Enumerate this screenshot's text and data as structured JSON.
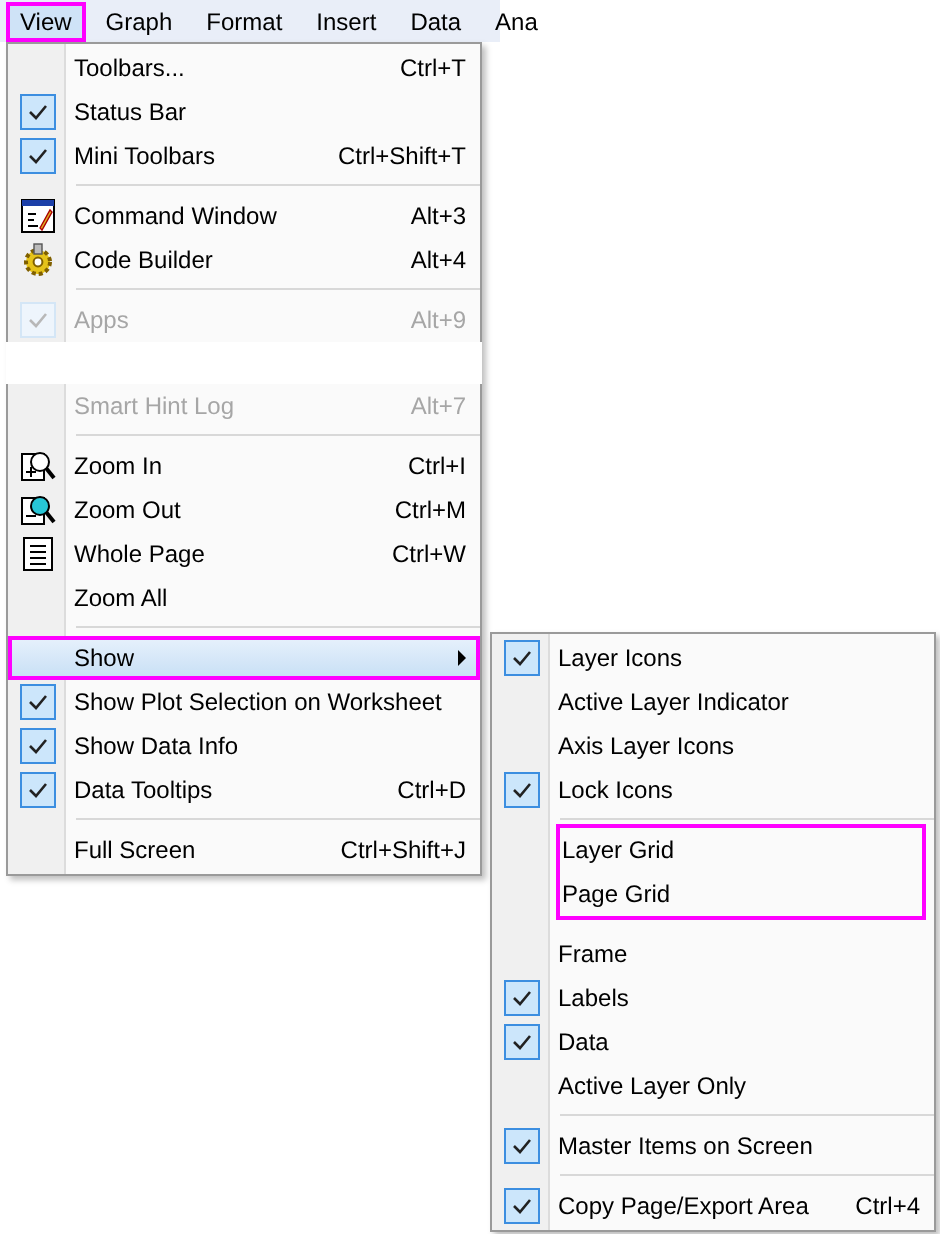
{
  "menu_bar": [
    {
      "label": "View",
      "selected": true
    },
    {
      "label": "Graph",
      "selected": false
    },
    {
      "label": "Format",
      "selected": false
    },
    {
      "label": "Insert",
      "selected": false
    },
    {
      "label": "Data",
      "selected": false
    },
    {
      "label": "Ana",
      "selected": false
    }
  ],
  "view_menu": [
    {
      "kind": "check",
      "label": "Toolbars...",
      "shortcut": "Ctrl+T",
      "checked": false,
      "disabled": false
    },
    {
      "kind": "check",
      "label": "Status Bar",
      "checked": true,
      "disabled": false
    },
    {
      "kind": "check",
      "label": "Mini Toolbars",
      "shortcut": "Ctrl+Shift+T",
      "checked": true,
      "disabled": false
    },
    {
      "kind": "separator"
    },
    {
      "kind": "icon",
      "label": "Command Window",
      "shortcut": "Alt+3",
      "disabled": false
    },
    {
      "kind": "icon",
      "label": "Code Builder",
      "shortcut": "Alt+4",
      "disabled": false
    },
    {
      "kind": "separator"
    },
    {
      "kind": "check",
      "label": "Apps",
      "shortcut": "Alt+9",
      "checked": true,
      "disabled": true
    },
    {
      "kind": "gap"
    },
    {
      "kind": "check",
      "label": "Smart Hint Log",
      "shortcut": "Alt+7",
      "checked": false,
      "disabled": true
    },
    {
      "kind": "separator"
    },
    {
      "kind": "icon",
      "label": "Zoom In",
      "shortcut": "Ctrl+I",
      "disabled": false
    },
    {
      "kind": "icon",
      "label": "Zoom Out",
      "shortcut": "Ctrl+M",
      "disabled": false
    },
    {
      "kind": "icon",
      "label": "Whole Page",
      "shortcut": "Ctrl+W",
      "disabled": false
    },
    {
      "kind": "check",
      "label": "Zoom All",
      "checked": false,
      "disabled": false
    },
    {
      "kind": "separator"
    },
    {
      "kind": "submenu",
      "label": "Show",
      "selected": true,
      "disabled": false
    },
    {
      "kind": "check",
      "label": "Show Plot Selection on Worksheet",
      "checked": true,
      "disabled": false
    },
    {
      "kind": "check",
      "label": "Show Data Info",
      "checked": true,
      "disabled": false
    },
    {
      "kind": "check",
      "label": "Data Tooltips",
      "shortcut": "Ctrl+D",
      "checked": true,
      "disabled": false
    },
    {
      "kind": "separator"
    },
    {
      "kind": "check",
      "label": "Full Screen",
      "shortcut": "Ctrl+Shift+J",
      "checked": false,
      "disabled": false
    }
  ],
  "show_submenu": [
    {
      "kind": "check",
      "label": "Layer Icons",
      "checked": true
    },
    {
      "kind": "check",
      "label": "Active Layer Indicator",
      "checked": false
    },
    {
      "kind": "check",
      "label": "Axis Layer Icons",
      "checked": false
    },
    {
      "kind": "check",
      "label": "Lock Icons",
      "checked": true
    },
    {
      "kind": "separator"
    },
    {
      "kind": "highlight_group",
      "children": [
        {
          "kind": "check",
          "label": "Layer Grid",
          "checked": false
        },
        {
          "kind": "check",
          "label": "Page Grid",
          "checked": false
        }
      ]
    },
    {
      "kind": "check",
      "label": "Frame",
      "checked": false
    },
    {
      "kind": "check",
      "label": "Labels",
      "checked": true
    },
    {
      "kind": "check",
      "label": "Data",
      "checked": true
    },
    {
      "kind": "check",
      "label": "Active Layer Only",
      "checked": false
    },
    {
      "kind": "separator"
    },
    {
      "kind": "check",
      "label": "Master Items on Screen",
      "checked": true
    },
    {
      "kind": "separator"
    },
    {
      "kind": "check",
      "label": "Copy Page/Export Area",
      "shortcut": "Ctrl+4",
      "checked": true
    }
  ]
}
